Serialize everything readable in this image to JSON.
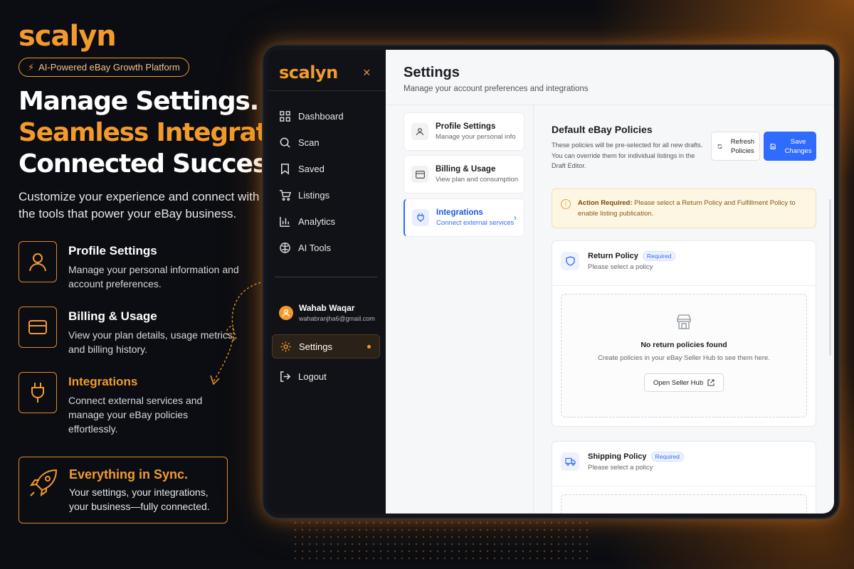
{
  "brand": "scalyn",
  "tagline": "AI-Powered eBay Growth Platform",
  "headline": [
    "Manage Settings.",
    "Seamless Integrations.",
    "Connected Success."
  ],
  "lead": "Customize your experience and connect with the tools that power your eBay business.",
  "features": [
    {
      "title": "Profile Settings",
      "desc": "Manage your personal information and account preferences.",
      "icon": "user-icon"
    },
    {
      "title": "Billing & Usage",
      "desc": "View your plan details, usage metrics, and billing history.",
      "icon": "card-icon"
    },
    {
      "title": "Integrations",
      "desc": "Connect external services and manage your eBay policies effortlessly.",
      "icon": "plug-icon"
    }
  ],
  "sync": {
    "title": "Everything in Sync.",
    "desc": "Your settings, your integrations, your business—fully connected.",
    "icon": "rocket-icon"
  },
  "app": {
    "logo": "scalyn",
    "close": "×",
    "nav": [
      {
        "label": "Dashboard",
        "icon": "grid-icon"
      },
      {
        "label": "Scan",
        "icon": "search-icon"
      },
      {
        "label": "Saved",
        "icon": "bookmark-icon"
      },
      {
        "label": "Listings",
        "icon": "cart-icon"
      },
      {
        "label": "Analytics",
        "icon": "chart-icon"
      },
      {
        "label": "AI Tools",
        "icon": "brain-icon"
      }
    ],
    "user": {
      "name": "Wahab Waqar",
      "email": "wahabranjha6@gmail.com"
    },
    "settings_label": "Settings",
    "logout_label": "Logout",
    "page": {
      "title": "Settings",
      "subtitle": "Manage your account preferences and integrations"
    },
    "tabs": [
      {
        "title": "Profile Settings",
        "desc": "Manage your personal info"
      },
      {
        "title": "Billing & Usage",
        "desc": "View plan and consumption"
      },
      {
        "title": "Integrations",
        "desc": "Connect external services"
      }
    ],
    "section": {
      "title": "Default eBay Policies",
      "desc": "These policies will be pre-selected for all new drafts. You can override them for individual listings in the Draft Editor.",
      "refresh": "Refresh Policies",
      "save": "Save Changes"
    },
    "alert": {
      "strong": "Action Required:",
      "text": " Please select a Return Policy and Fulfillment Policy to enable listing publication."
    },
    "return_card": {
      "title": "Return Policy",
      "badge": "Required",
      "desc": "Please select a policy",
      "empty_title": "No return policies found",
      "empty_desc": "Create policies in your eBay Seller Hub to see them here.",
      "button": "Open Seller Hub"
    },
    "shipping_card": {
      "title": "Shipping Policy",
      "badge": "Required",
      "desc": "Please select a policy"
    }
  },
  "colors": {
    "accent": "#f39a2b",
    "primary": "#2f6bff",
    "background": "#0b0d12"
  }
}
